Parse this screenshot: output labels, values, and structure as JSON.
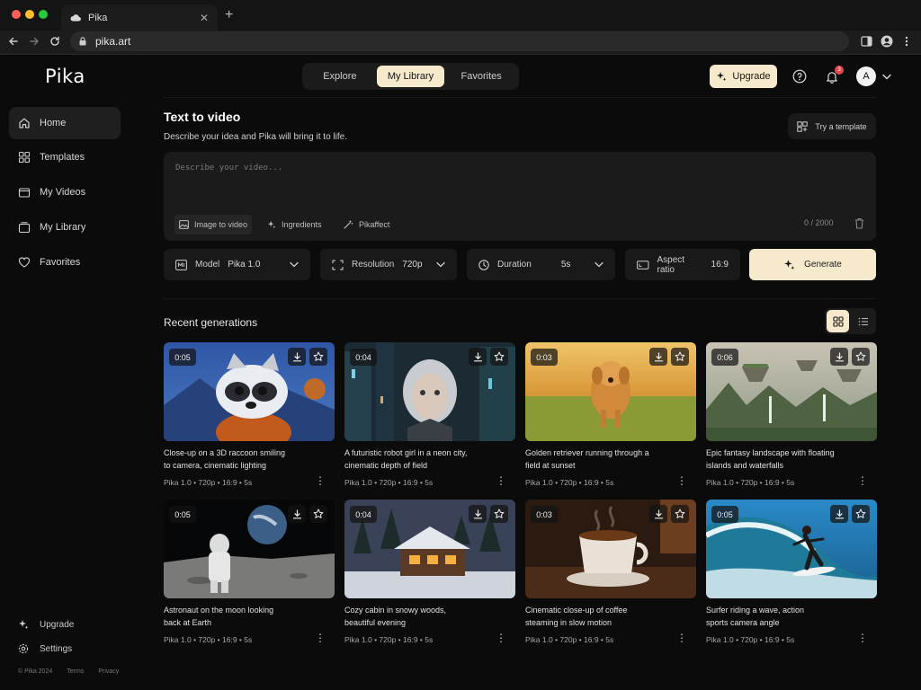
{
  "browser": {
    "tab_title": "Pika",
    "url": "pika.art"
  },
  "app": {
    "logo": "Pika",
    "top_tabs": [
      "Explore",
      "My Library",
      "Favorites"
    ],
    "active_top_tab": "My Library",
    "upgrade_label": "Upgrade",
    "notification_count": "3",
    "avatar_initial": "A"
  },
  "sidebar": {
    "items": [
      {
        "label": "Home",
        "icon": "home-icon"
      },
      {
        "label": "Templates",
        "icon": "grid-icon"
      },
      {
        "label": "My Videos",
        "icon": "folder-icon"
      },
      {
        "label": "My Library",
        "icon": "library-icon"
      },
      {
        "label": "Favorites",
        "icon": "heart-icon"
      }
    ],
    "footer": {
      "upgrade": "Upgrade",
      "settings": "Settings",
      "copyright": "© Pika 2024",
      "terms": "Terms",
      "privacy": "Privacy"
    }
  },
  "composer": {
    "title": "Text to video",
    "subtitle": "Describe your idea and Pika will bring it to life.",
    "template_button": "Try a template",
    "placeholder": "Describe your video...",
    "chips": [
      "Image to video",
      "Ingredients",
      "Pikaffect"
    ],
    "counter": "0 / 2000"
  },
  "controls": {
    "model_label": "Model",
    "model_value": "Pika 1.0",
    "resolution_label": "Resolution",
    "resolution_value": "720p",
    "duration_label": "Duration",
    "duration_value": "5s",
    "aspect_label": "Aspect ratio",
    "aspect_value": "16:9",
    "generate_label": "Generate"
  },
  "recent": {
    "title": "Recent generations",
    "cards": [
      {
        "duration": "0:05",
        "caption_l1": "Close-up on a 3D raccoon smiling",
        "caption_l2": "to camera, cinematic lighting",
        "meta": "Pika 1.0  •  720p  •  16:9  •  5s"
      },
      {
        "duration": "0:04",
        "caption_l1": "A futuristic robot girl in a neon city,",
        "caption_l2": "cinematic depth of field",
        "meta": "Pika 1.0  •  720p  •  16:9  •  5s"
      },
      {
        "duration": "0:03",
        "caption_l1": "Golden retriever running through a",
        "caption_l2": "field at sunset",
        "meta": "Pika 1.0  •  720p  •  16:9  •  5s"
      },
      {
        "duration": "0:06",
        "caption_l1": "Epic fantasy landscape with floating",
        "caption_l2": "islands and waterfalls",
        "meta": "Pika 1.0  •  720p  •  16:9  •  5s"
      },
      {
        "duration": "0:05",
        "caption_l1": "Astronaut on the moon looking",
        "caption_l2": "back at Earth",
        "meta": "Pika 1.0  •  720p  •  16:9  •  5s"
      },
      {
        "duration": "0:04",
        "caption_l1": "Cozy cabin in snowy woods,",
        "caption_l2": "beautiful evening",
        "meta": "Pika 1.0  •  720p  •  16:9  •  5s"
      },
      {
        "duration": "0:03",
        "caption_l1": "Cinematic close-up of coffee",
        "caption_l2": "steaming in slow motion",
        "meta": "Pika 1.0  •  720p  •  16:9  •  5s"
      },
      {
        "duration": "0:05",
        "caption_l1": "Surfer riding a wave, action",
        "caption_l2": "sports camera angle",
        "meta": "Pika 1.0  •  720p  •  16:9  •  5s"
      }
    ]
  },
  "colors": {
    "accent": "#f6e9cc",
    "background": "#0b0b0b",
    "surface": "#1b1b1c",
    "notification": "#e5484d"
  }
}
